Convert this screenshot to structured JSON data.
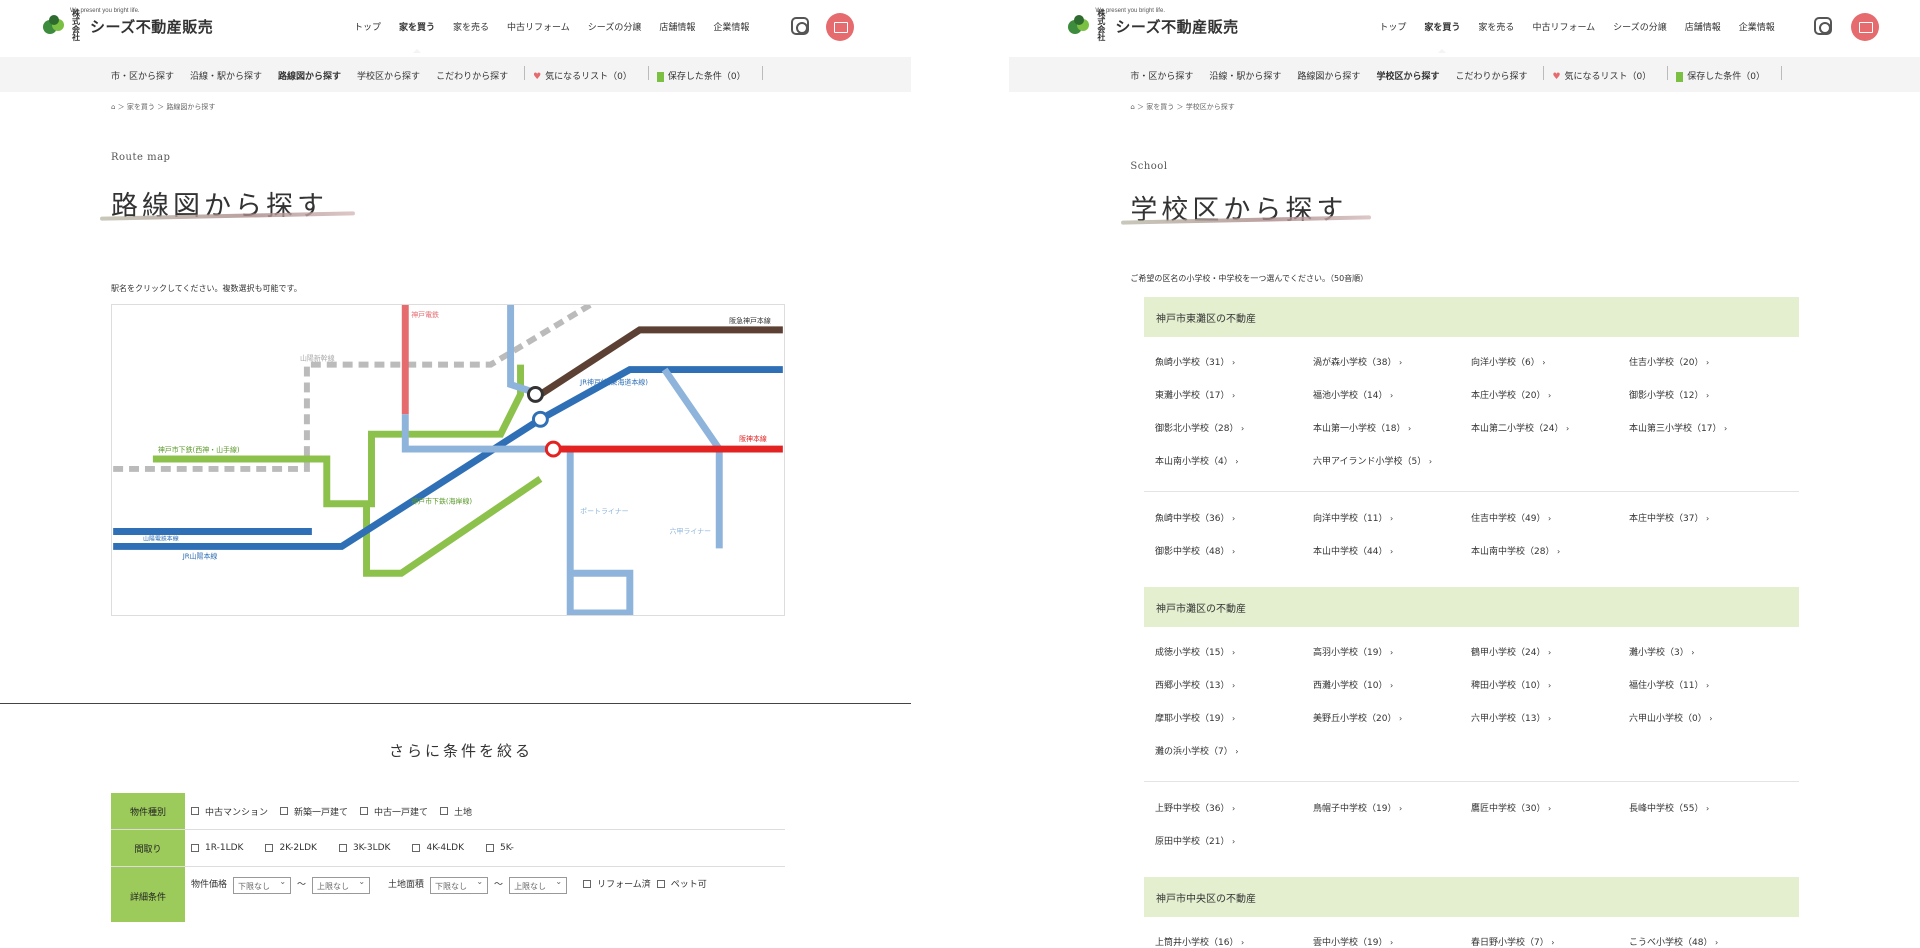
{
  "header": {
    "tagline": "We present you bright life.",
    "logo_kk": "株式会社",
    "company": "シーズ不動産販売",
    "nav": [
      "トップ",
      "家を買う",
      "家を売る",
      "中古リフォーム",
      "シーズの分譲",
      "店舗情報",
      "企業情報"
    ],
    "active_nav": "家を買う"
  },
  "subnav": {
    "items": [
      "市・区から探す",
      "沿線・駅から探す",
      "路線図から探す",
      "学校区から探す",
      "こだわりから探す"
    ],
    "favorites": "気になるリスト（0）",
    "saved": "保存した条件（0）"
  },
  "left": {
    "breadcrumb": "⌂ ＞ 家を買う ＞ 路線図から探す",
    "eyebrow": "Route map",
    "title": "路線図から探す",
    "instruction": "駅名をクリックしてください。複数選択も可能です。",
    "map_labels": {
      "kobe_line": "神戸電鉄",
      "sanyo_shinkansen": "山陽新幹線",
      "seishin": "神戸市下鉄(西神・山手線)",
      "kaigan": "神戸市下鉄(海岸線)",
      "sanyo_main": "JR山陽本線",
      "sanyo_dentetsu": "山陽電鉄本線",
      "hankyu_kobe": "阪急神戸本線",
      "hanshin": "阪神本線",
      "portliner": "ポートライナー",
      "rokko_liner": "六甲ライナー",
      "jr_kobe": "JR神戸線(東海道本線)"
    },
    "narrow_title": "さらに条件を絞る",
    "filters": {
      "type_label": "物件種別",
      "types": [
        "中古マンション",
        "新築一戸建て",
        "中古一戸建て",
        "土地"
      ],
      "layout_label": "間取り",
      "layouts": [
        "1R-1LDK",
        "2K-2LDK",
        "3K-3LDK",
        "4K-4LDK",
        "5K-"
      ],
      "detail_label": "詳細条件",
      "price_label": "物件価格",
      "area_label": "土地面積",
      "min": "下限なし",
      "max": "上限なし",
      "tilde": "〜",
      "extras": [
        "リフォーム済",
        "ペット可"
      ]
    }
  },
  "right": {
    "breadcrumb": "⌂ ＞ 家を買う ＞ 学校区から探す",
    "eyebrow": "School",
    "title": "学校区から探す",
    "instruction": "ご希望の区名の小学校・中学校を一つ選んでください。（50音順）",
    "regions": [
      {
        "name": "神戸市東灘区の不動産",
        "elementary": [
          "魚崎小学校（31）",
          "渦が森小学校（38）",
          "向洋小学校（6）",
          "住吉小学校（20）",
          "東灘小学校（17）",
          "福池小学校（14）",
          "本庄小学校（20）",
          "御影小学校（12）",
          "御影北小学校（28）",
          "本山第一小学校（18）",
          "本山第二小学校（24）",
          "本山第三小学校（17）",
          "本山南小学校（4）",
          "六甲アイランド小学校（5）"
        ],
        "junior": [
          "魚崎中学校（36）",
          "向洋中学校（11）",
          "住吉中学校（49）",
          "本庄中学校（37）",
          "御影中学校（48）",
          "本山中学校（44）",
          "本山南中学校（28）"
        ]
      },
      {
        "name": "神戸市灘区の不動産",
        "elementary": [
          "成徳小学校（15）",
          "高羽小学校（19）",
          "鶴甲小学校（24）",
          "灘小学校（3）",
          "西郷小学校（13）",
          "西灘小学校（10）",
          "稗田小学校（10）",
          "福住小学校（11）",
          "摩耶小学校（19）",
          "美野丘小学校（20）",
          "六甲小学校（13）",
          "六甲山小学校（0）",
          "灘の浜小学校（7）"
        ],
        "junior": [
          "上野中学校（36）",
          "鳥帽子中学校（19）",
          "鷹匠中学校（30）",
          "長峰中学校（55）",
          "原田中学校（21）"
        ]
      },
      {
        "name": "神戸市中央区の不動産",
        "elementary": [
          "上筒井小学校（16）",
          "雲中小学校（19）",
          "春日野小学校（7）",
          "こうべ小学校（48）"
        ],
        "junior": []
      }
    ]
  }
}
